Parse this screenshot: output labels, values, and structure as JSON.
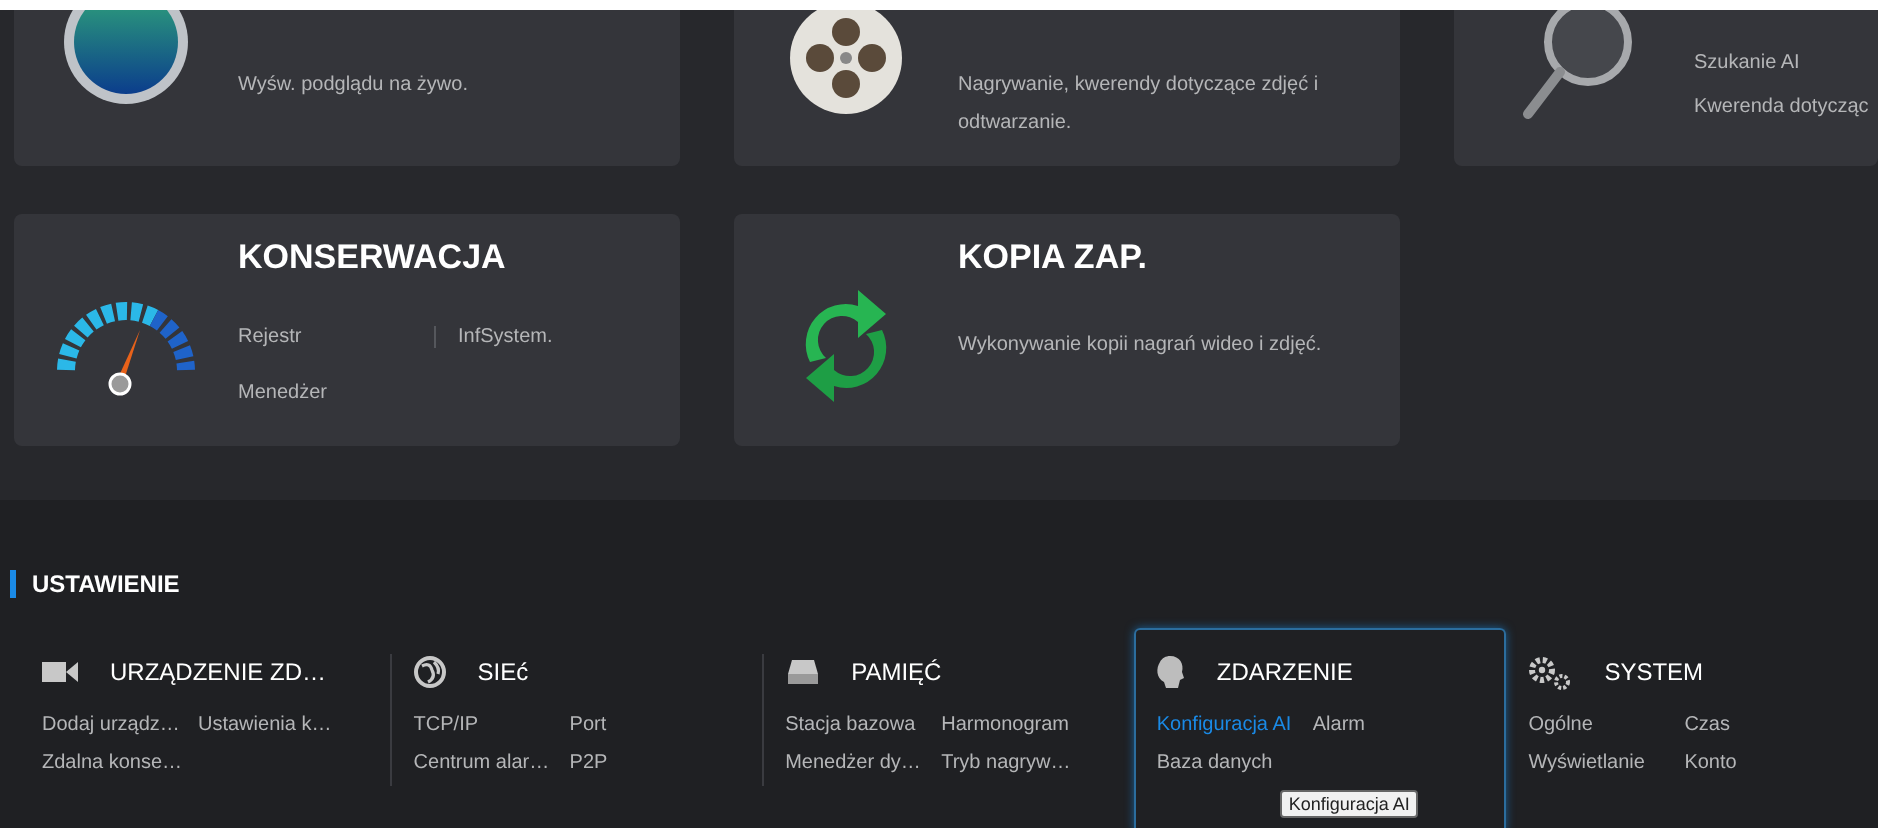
{
  "tiles": [
    {
      "kind": "desc",
      "text": "Wyśw. podglądu na żywo."
    },
    {
      "kind": "desc",
      "text": "Nagrywanie, kwerendy dotyczące zdjęć i odtwarzanie."
    },
    {
      "kind": "links",
      "links": [
        "Szukanie AI",
        "Kwerenda dotycząc"
      ]
    },
    {
      "kind": "links",
      "title": "KONSERWACJA",
      "links": [
        "Rejestr",
        "InfSystem.",
        "Menedżer"
      ]
    },
    {
      "kind": "desc",
      "title": "KOPIA ZAP.",
      "text": "Wykonywanie kopii nagrań wideo i zdjęć."
    }
  ],
  "settings": {
    "title": "USTAWIENIE",
    "categories": [
      {
        "title": "URZĄDZENIE ZD…",
        "selected": false,
        "links": [
          {
            "label": "Dodaj urządz…",
            "selected": false
          },
          {
            "label": "Ustawienia k…",
            "selected": false
          },
          {
            "label": "Zdalna konse…",
            "selected": false
          }
        ]
      },
      {
        "title": "SIEć",
        "selected": false,
        "links": [
          {
            "label": "TCP/IP",
            "selected": false
          },
          {
            "label": "Port",
            "selected": false
          },
          {
            "label": "Centrum alar…",
            "selected": false
          },
          {
            "label": "P2P",
            "selected": false
          }
        ]
      },
      {
        "title": "PAMIĘĆ",
        "selected": false,
        "links": [
          {
            "label": "Stacja bazowa",
            "selected": false
          },
          {
            "label": "Harmonogram",
            "selected": false
          },
          {
            "label": "Menedżer dy…",
            "selected": false
          },
          {
            "label": "Tryb nagryw…",
            "selected": false
          }
        ]
      },
      {
        "title": "ZDARZENIE",
        "selected": true,
        "links": [
          {
            "label": "Konfiguracja AI",
            "selected": true
          },
          {
            "label": "Alarm",
            "selected": false
          },
          {
            "label": "Baza danych",
            "selected": false
          }
        ]
      },
      {
        "title": "SYSTEM",
        "selected": false,
        "links": [
          {
            "label": "Ogólne",
            "selected": false
          },
          {
            "label": "Czas",
            "selected": false
          },
          {
            "label": "Wyświetlanie",
            "selected": false
          },
          {
            "label": "Konto",
            "selected": false
          }
        ]
      }
    ]
  },
  "tooltip": "Konfiguracja AI"
}
